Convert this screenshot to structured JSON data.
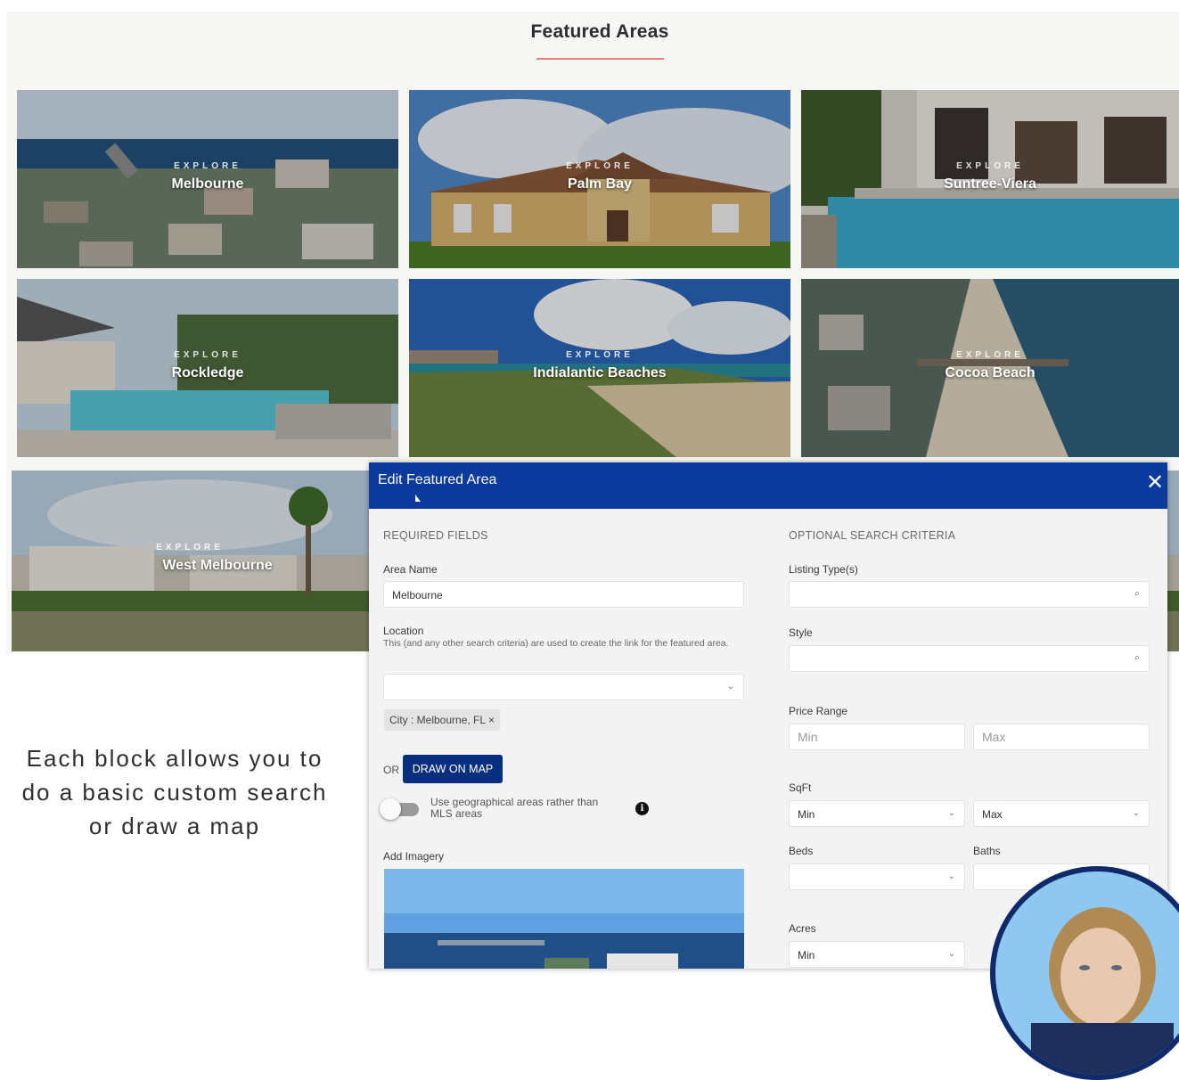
{
  "page": {
    "section_title": "Featured Areas",
    "caption": "Each block allows you to do a basic custom search or draw a map"
  },
  "areas": [
    {
      "explore": "EXPLORE",
      "name": "Melbourne"
    },
    {
      "explore": "EXPLORE",
      "name": "Palm Bay"
    },
    {
      "explore": "EXPLORE",
      "name": "Suntree-Viera"
    },
    {
      "explore": "EXPLORE",
      "name": "Rockledge"
    },
    {
      "explore": "EXPLORE",
      "name": "Indialantic Beaches"
    },
    {
      "explore": "EXPLORE",
      "name": "Cocoa Beach"
    },
    {
      "explore": "EXPLORE",
      "name": "West Melbourne"
    }
  ],
  "modal": {
    "title": "Edit Featured Area",
    "close_icon": "close-icon",
    "required": {
      "heading": "REQUIRED FIELDS",
      "area_name_label": "Area Name",
      "area_name_value": "Melbourne",
      "location_label": "Location",
      "location_help": "This (and any other search criteria) are used to create the link for the featured area.",
      "location_value": "",
      "chip": "City : Melbourne, FL",
      "chip_remove": "×",
      "or": "OR",
      "draw_button": "DRAW ON MAP",
      "toggle_label": "Use geographical areas rather than MLS areas",
      "toggle_on": false,
      "info_glyph": "i",
      "add_imagery_label": "Add Imagery"
    },
    "optional": {
      "heading": "OPTIONAL SEARCH CRITERIA",
      "listing_type_label": "Listing Type(s)",
      "style_label": "Style",
      "price_label": "Price Range",
      "price_min_placeholder": "Min",
      "price_max_placeholder": "Max",
      "sqft_label": "SqFt",
      "sqft_min": "Min",
      "sqft_max": "Max",
      "beds_label": "Beds",
      "baths_label": "Baths",
      "acres_label": "Acres",
      "acres_min": "Min"
    }
  },
  "colors": {
    "modal_header": "#0a3a9c",
    "draw_button": "#082e80",
    "title_rule": "#e57c7c",
    "avatar_ring": "#0f2a6a"
  }
}
